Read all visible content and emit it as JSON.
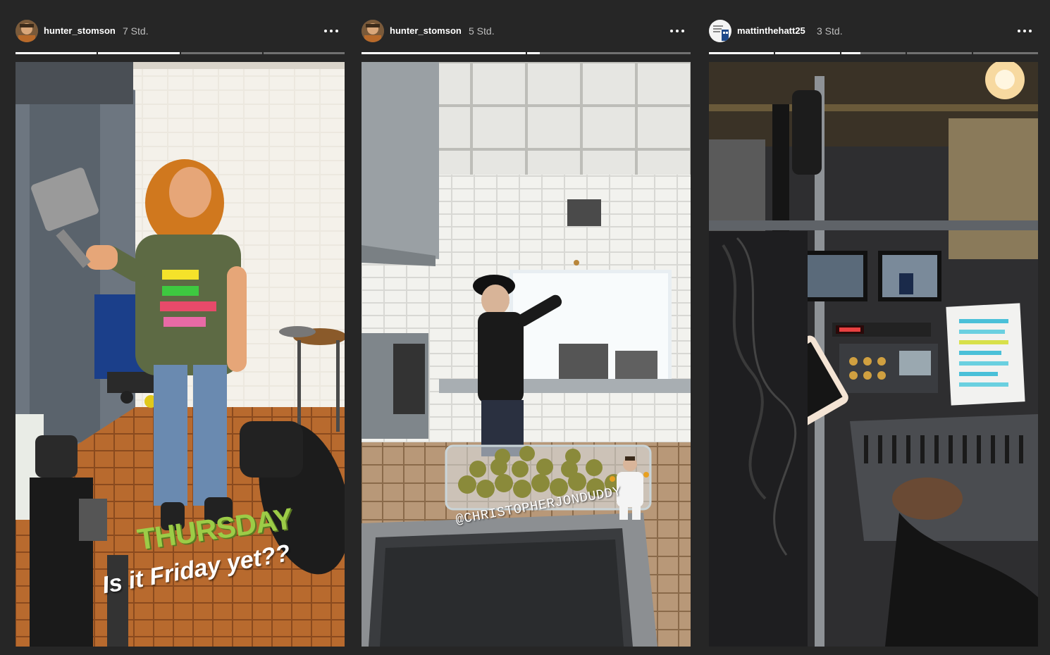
{
  "stories": [
    {
      "username": "hunter_stomson",
      "time": "7 Std.",
      "more_label": "More options",
      "progress": [
        1,
        1,
        0,
        0
      ],
      "overlay": {
        "title": "THURSDAY",
        "subtitle": "Is it Friday yet??"
      },
      "image_description_icon": "kitchen-photo"
    },
    {
      "username": "hunter_stomson",
      "time": "5 Std.",
      "more_label": "More options",
      "progress": [
        1,
        0.08
      ],
      "overlay": {
        "mention": "@CHRISTOPHERJONDUDDY"
      },
      "image_description_icon": "kitchen-juggling-photo"
    },
    {
      "username": "mattinthehatt25",
      "time": "3 Std.",
      "more_label": "More options",
      "progress": [
        1,
        1,
        0.3,
        0,
        0
      ],
      "image_description_icon": "sound-cart-photo"
    }
  ],
  "colors": {
    "background": "#262626",
    "progress_track": "rgba(255,255,255,0.35)",
    "progress_fill": "#ffffff",
    "thursday_green": "#9ccc47"
  }
}
